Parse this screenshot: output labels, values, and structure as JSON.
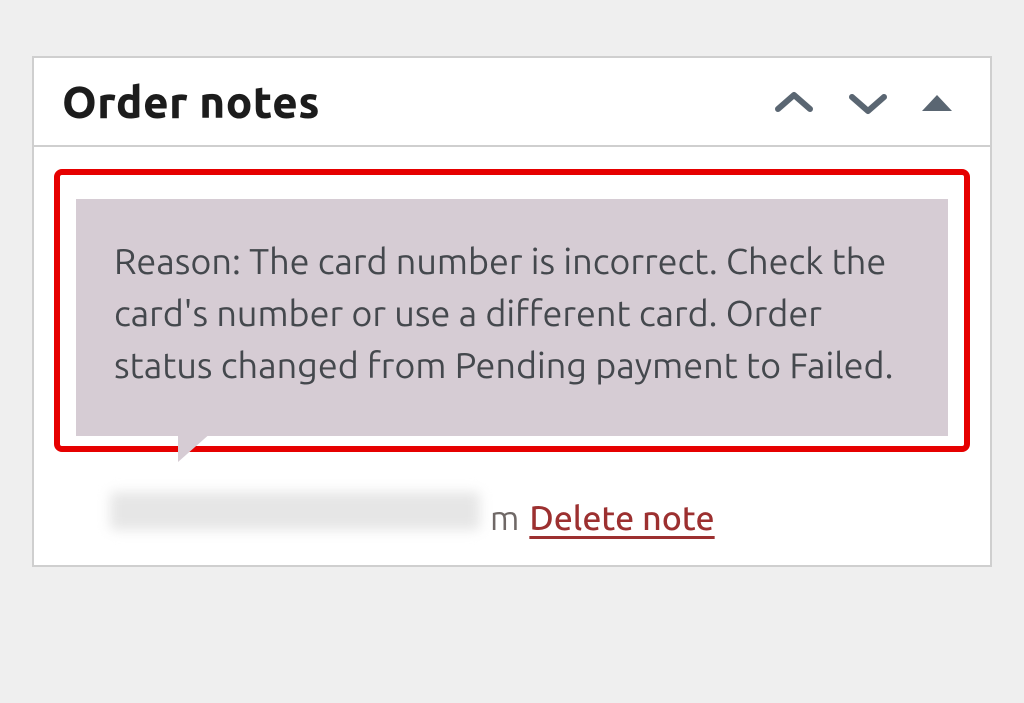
{
  "panel": {
    "title": "Order notes",
    "controls": {
      "move_up": "Move up",
      "move_down": "Move down",
      "toggle": "Toggle"
    }
  },
  "notes": [
    {
      "content": "Reason: The card number is incorrect. Check the card's number or use a different card. Order status changed from Pending payment to Failed.",
      "meta_fragment": "m",
      "delete_label": "Delete note"
    }
  ],
  "colors": {
    "highlight_border": "#e60000",
    "note_bg": "#d6ccd4",
    "link": "#9c3030"
  }
}
